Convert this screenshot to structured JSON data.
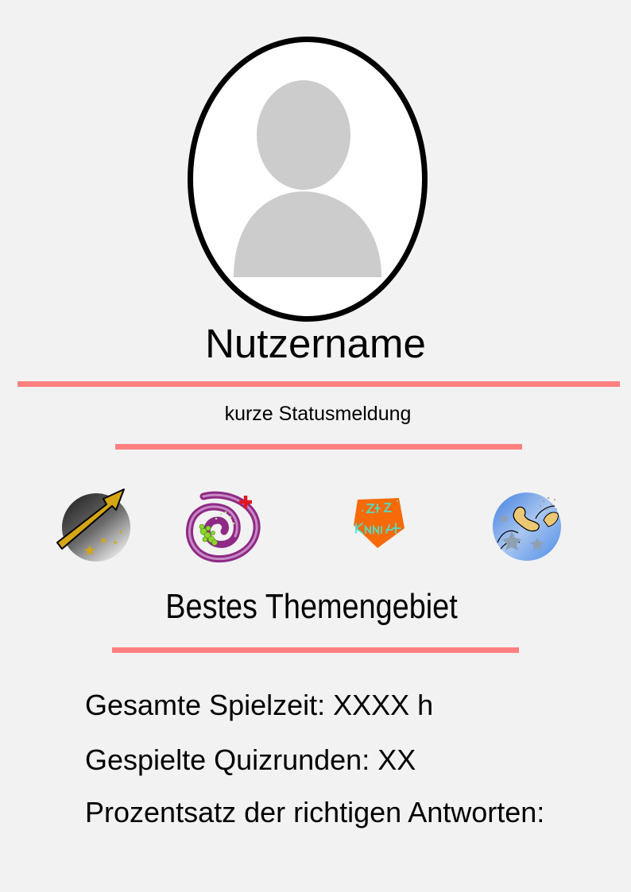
{
  "profile": {
    "username": "Nutzername",
    "status_message": "kurze Statusmeldung"
  },
  "badges": [
    {
      "icon": "arrow-stars-badge-icon"
    },
    {
      "icon": "spiral-badge-icon"
    },
    {
      "icon": "art-pentagon-badge-icon"
    },
    {
      "icon": "blue-space-badge-icon"
    }
  ],
  "best_topic": {
    "label": "Bestes Themengebiet"
  },
  "stats": {
    "total_playtime": "Gesamte Spielzeit: XXXX h",
    "quiz_rounds": "Gespielte Quizrunden: XX",
    "correct_percentage": "Prozentsatz der richtigen Antworten:"
  },
  "colors": {
    "background": "#f2f2f2",
    "divider": "#ff8080",
    "avatar_placeholder": "#cccccc"
  }
}
